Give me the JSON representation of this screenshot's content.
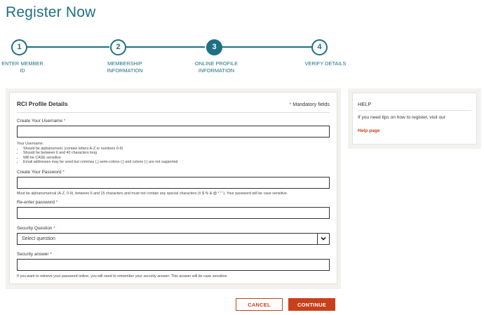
{
  "page": {
    "title": "Register Now"
  },
  "stepper": {
    "steps": [
      {
        "number": "1",
        "label_line1": "ENTER MEMBER",
        "label_line2": "ID"
      },
      {
        "number": "2",
        "label_line1": "MEMBERSHIP",
        "label_line2": "INFORMATION"
      },
      {
        "number": "3",
        "label_line1": "ONLINE PROFILE",
        "label_line2": "INFORMATION"
      },
      {
        "number": "4",
        "label_line1": "VERIFY DETAILS",
        "label_line2": ""
      }
    ],
    "active_step": 3
  },
  "form": {
    "title": "RCI Profile Details",
    "mandatory_star": "*",
    "mandatory_text": "Mandatory fields",
    "username": {
      "label": "Create Your Username",
      "value": "",
      "hint_title": "Your Username:",
      "hints": [
        "Should be alphanumeric (contain letters A-Z or numbers 0-9)",
        "Should be between 6 and 40 characters long",
        "Will be CASE sensitive",
        "Email addresses may be used but commas (,) semi-colons (;) and colons (:) are not supported"
      ]
    },
    "password": {
      "label": "Create Your Password",
      "value": "",
      "hint": "Must be alphanumerical (A-Z, 0-9), between 6 and 15 characters and must not contain any special characters (# $ % & @ * \" '). Your password will be case sensitive."
    },
    "reenter_password": {
      "label": "Re-enter password",
      "value": ""
    },
    "security_question": {
      "label": "Security Question",
      "selected": "Select question"
    },
    "security_answer": {
      "label": "Security answer",
      "value": "",
      "hint": "If you want to retrieve your password online, you will need to remember your security answer. This answer will be case sensitive."
    },
    "required_star": "*"
  },
  "help": {
    "title": "HELP",
    "body": "If you need tips on how to register, visit our",
    "link_text": "Help page"
  },
  "buttons": {
    "cancel": "CANCEL",
    "continue": "CONTINUE"
  },
  "colors": {
    "teal": "#1e6f84",
    "accent": "#c8401a",
    "panel_bg": "#f3f2ef"
  },
  "icons": {
    "select_toggle": "chevron-down-icon"
  }
}
